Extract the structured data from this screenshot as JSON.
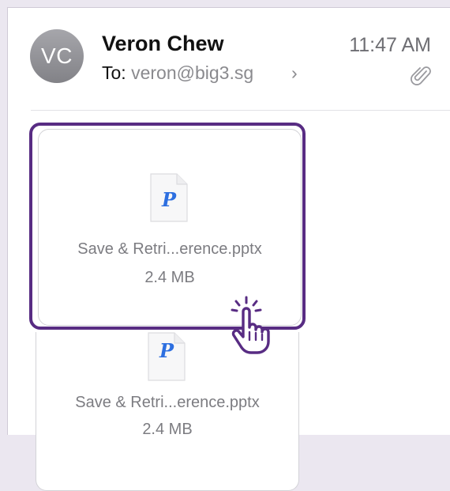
{
  "email": {
    "avatar_initials": "VC",
    "sender_name": "Veron Chew",
    "to_label": "To:",
    "to_address": "veron@big3.sg",
    "chevron": "›",
    "time": "11:47 AM",
    "has_attachment_icon": "paperclip-icon"
  },
  "attachments": [
    {
      "icon": "powerpoint-file-icon",
      "icon_letter": "P",
      "filename": "Save & Retri...erence.pptx",
      "size": "2.4 MB"
    },
    {
      "icon": "powerpoint-file-icon",
      "icon_letter": "P",
      "filename": "Save & Retri...erence.pptx",
      "size": "2.4 MB"
    }
  ],
  "overlay": {
    "highlight_color": "#582c83",
    "pointer_icon": "tap-hand-icon"
  }
}
